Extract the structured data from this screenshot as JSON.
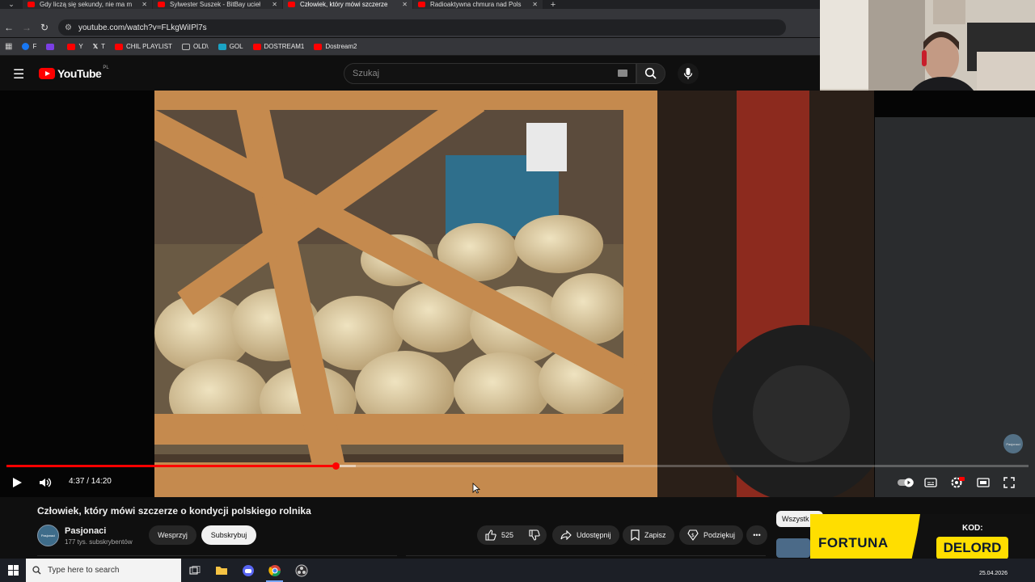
{
  "browser": {
    "tabs": [
      {
        "title": "Gdy liczą się sekundy, nie ma m",
        "active": false
      },
      {
        "title": "Sylwester Suszek - BitBay ucieł",
        "active": false
      },
      {
        "title": "Człowiek, który mówi szczerze",
        "active": true
      },
      {
        "title": "Radioaktywna chmura nad Pols",
        "active": false
      }
    ],
    "url": "youtube.com/watch?v=FLkgWiIPl7s",
    "bookmarks": [
      {
        "label": "F",
        "color": "#1877f2"
      },
      {
        "label": "",
        "color": "#7b3fe4"
      },
      {
        "label": "Y",
        "color": "#ff0000"
      },
      {
        "label": "T",
        "color": "#ffffff"
      },
      {
        "label": "CHIL PLAYLIST",
        "color": "#ff0000"
      },
      {
        "label": "OLD\\",
        "color": "#888888"
      },
      {
        "label": "GOL",
        "color": "#1aa3c4"
      },
      {
        "label": "DOSTREAM1",
        "color": "#ff0000"
      },
      {
        "label": "Dostream2",
        "color": "#ff0000"
      }
    ]
  },
  "youtube": {
    "logo_text": "YouTube",
    "region": "PL",
    "search_placeholder": "Szukaj"
  },
  "player": {
    "time": "4:37 / 14:20",
    "progress": 0.322,
    "watermark": "Pasjonaci"
  },
  "video": {
    "title": "Człowiek, który mówi szczerze o kondycji polskiego rolnika",
    "channel": "Pasjonaci",
    "subscribers": "177 tys. subskrybentów",
    "support_label": "Wesprzyj",
    "subscribe_label": "Subskrybuj",
    "likes": "525",
    "share_label": "Udostępnij",
    "save_label": "Zapisz",
    "thanks_label": "Podziękuj"
  },
  "sidebar": {
    "chip_all": "Wszystk"
  },
  "promo": {
    "brand": "FORTUNA",
    "code_label": "KOD:",
    "code": "DELORD"
  },
  "taskbar": {
    "search_placeholder": "Type here to search",
    "date": "25.04.2026"
  },
  "colors": {
    "accent": "#ff0000",
    "promo_yellow": "#ffde00"
  }
}
